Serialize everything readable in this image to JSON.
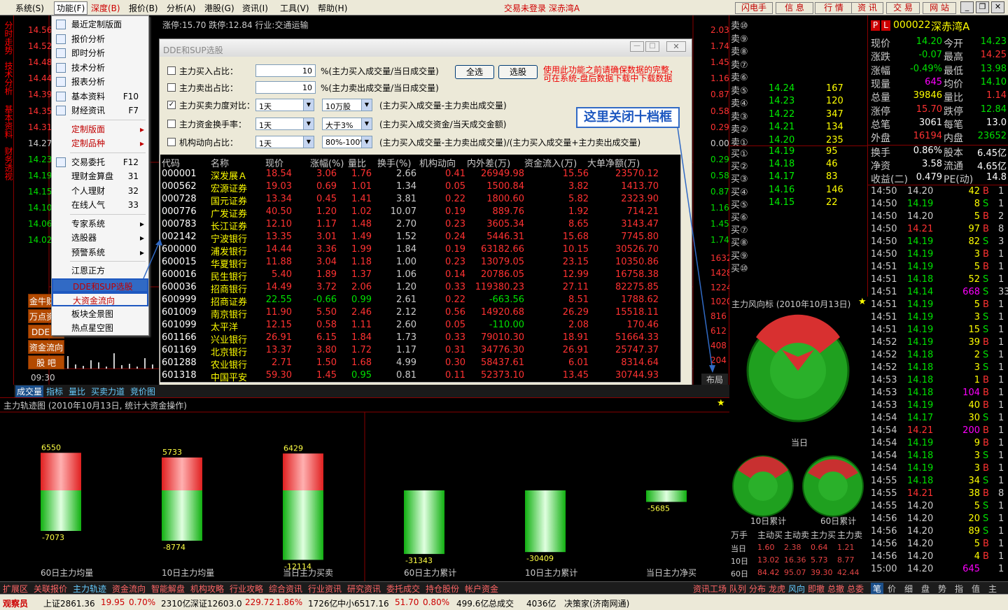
{
  "menubar": {
    "items": [
      "系统(S)",
      "功能(F)",
      "深度(B)",
      "报价(B)",
      "分析(A)",
      "港股(G)",
      "资讯(I)",
      "工具(V)",
      "帮助(H)"
    ],
    "status": "交易未登录 深赤湾A",
    "buttons": [
      "闪电手",
      "信 息",
      "行 情",
      "资 讯",
      "交 易",
      "网 站"
    ]
  },
  "leftbar": {
    "tabs": [
      "分时走势",
      "技术分析",
      "基本资料",
      "财务透视"
    ]
  },
  "chart": {
    "header": "涨停:15.70 跌停:12.84 行业:交通运输",
    "yleft": [
      "14.56",
      "14.52",
      "14.48",
      "14.44",
      "14.39",
      "14.35",
      "14.31",
      "14.27",
      "14.23",
      "14.19",
      "14.15",
      "14.10",
      "14.06",
      "14.02"
    ],
    "yright": [
      "2.03%",
      "1.74%",
      "1.45%",
      "1.16%",
      "0.87%",
      "0.58%",
      "0.29%",
      "0.00%",
      "0.29%",
      "0.58%",
      "0.87%",
      "1.16%",
      "1.45%",
      "1.74%"
    ],
    "yvol": [
      "1632",
      "1428",
      "1224",
      "1020",
      "816",
      "612",
      "408",
      "204"
    ],
    "time": "09:30",
    "layout_btn": "布局",
    "side_buttons": [
      "金牛财经",
      "万点资讯",
      "DDE 数据",
      "资金流向",
      "股 吧"
    ]
  },
  "func_menu": {
    "items": [
      {
        "label": "最近定制版面",
        "key": ""
      },
      {
        "label": "报价分析",
        "key": ""
      },
      {
        "label": "即时分析",
        "key": ""
      },
      {
        "label": "技术分析",
        "key": ""
      },
      {
        "label": "报表分析",
        "key": ""
      },
      {
        "label": "基本资料",
        "key": "F10"
      },
      {
        "label": "财经资讯",
        "key": "F7"
      },
      {
        "label": "定制版面",
        "key": ""
      },
      {
        "label": "定制品种",
        "key": ""
      },
      {
        "label": "交易委托",
        "key": "F12"
      },
      {
        "label": "理财金算盘",
        "key": "31"
      },
      {
        "label": "个人理财",
        "key": "32"
      },
      {
        "label": "在线人气",
        "key": "33"
      },
      {
        "label": "专家系统",
        "key": ""
      },
      {
        "label": "选股器",
        "key": ""
      },
      {
        "label": "预警系统",
        "key": ""
      },
      {
        "label": "江恩正方",
        "key": ""
      },
      {
        "label": "DDE和SUP选股",
        "key": ""
      },
      {
        "label": "大资金流向",
        "key": ""
      },
      {
        "label": "板块全景图",
        "key": ""
      },
      {
        "label": "热点星空图",
        "key": ""
      }
    ]
  },
  "dialog": {
    "title": "DDE和SUP选股",
    "rows": [
      {
        "label": "主力买入占比：",
        "checked": false,
        "value": "10",
        "desc": "%(主力买入成交量/当日成交量)"
      },
      {
        "label": "主力卖出占比：",
        "checked": false,
        "value": "10",
        "desc": "%(主力卖出成交量/当日成交量)"
      },
      {
        "label": "主力买卖力度对比：",
        "checked": true,
        "sel1": "1天",
        "sel2": "10万股",
        "desc": "(主力买入成交量-主力卖出成交量)"
      },
      {
        "label": "主力资金换手率：",
        "checked": false,
        "sel1": "1天",
        "sel2": "大于3%",
        "desc": "(主力买入成交资金/当天成交金额)"
      },
      {
        "label": "机构动向占比：",
        "checked": false,
        "sel1": "1天",
        "sel2": "80%-100%",
        "desc": "(主力买入成交量-主力卖出成交量)/(主力买入成交量+主力卖出成交量)"
      }
    ],
    "btn_all": "全选",
    "btn_pick": "选股",
    "warning1": "使用此功能之前请确保数据的完整，",
    "warning2": "可在系统-盘后数据下载中下载数据",
    "annotation": "这里关闭十档框",
    "columns": [
      "代码",
      "名称",
      "现价",
      "涨幅(%)",
      "量比",
      "换手(%)",
      "机构动向",
      "内外差(万)",
      "资金流入(万)",
      "大单净额(万)"
    ],
    "table": [
      [
        "000001",
        "深发展Ａ",
        "18.54",
        "3.06",
        "1.76",
        "2.66",
        "0.41",
        "26949.98",
        "15.56",
        "23570.12"
      ],
      [
        "000562",
        "宏源证券",
        "19.03",
        "0.69",
        "1.01",
        "1.34",
        "0.05",
        "1500.84",
        "3.82",
        "1413.70"
      ],
      [
        "000728",
        "国元证券",
        "13.34",
        "0.45",
        "1.41",
        "3.81",
        "0.22",
        "1800.60",
        "5.82",
        "2323.90"
      ],
      [
        "000776",
        "广发证券",
        "40.50",
        "1.20",
        "1.02",
        "10.07",
        "0.19",
        "889.76",
        "1.92",
        "714.21"
      ],
      [
        "000783",
        "长江证券",
        "12.10",
        "1.17",
        "1.48",
        "2.70",
        "0.23",
        "3605.34",
        "8.65",
        "3143.47"
      ],
      [
        "002142",
        "宁波银行",
        "13.35",
        "3.01",
        "1.49",
        "1.52",
        "0.24",
        "5446.31",
        "15.68",
        "7745.80"
      ],
      [
        "600000",
        "浦发银行",
        "14.44",
        "3.36",
        "1.99",
        "1.84",
        "0.19",
        "63182.66",
        "10.15",
        "30526.70"
      ],
      [
        "600015",
        "华夏银行",
        "11.88",
        "3.04",
        "1.18",
        "1.00",
        "0.23",
        "13079.05",
        "23.15",
        "10350.86"
      ],
      [
        "600016",
        "民生银行",
        "5.40",
        "1.89",
        "1.37",
        "1.06",
        "0.14",
        "20786.05",
        "12.99",
        "16758.38"
      ],
      [
        "600036",
        "招商银行",
        "14.49",
        "3.72",
        "2.06",
        "1.20",
        "0.33",
        "119380.23",
        "27.11",
        "82275.85"
      ],
      [
        "600999",
        "招商证券",
        "22.55",
        "-0.66",
        "0.99",
        "2.61",
        "0.22",
        "-663.56",
        "8.51",
        "1788.62"
      ],
      [
        "601009",
        "南京银行",
        "11.90",
        "5.50",
        "2.46",
        "2.12",
        "0.56",
        "14920.68",
        "26.29",
        "15518.11"
      ],
      [
        "601099",
        "太平洋",
        "12.15",
        "0.58",
        "1.11",
        "2.60",
        "0.05",
        "-110.00",
        "2.08",
        "170.46"
      ],
      [
        "601166",
        "兴业银行",
        "26.91",
        "6.15",
        "1.84",
        "1.73",
        "0.33",
        "79010.30",
        "18.91",
        "51664.33"
      ],
      [
        "601169",
        "北京银行",
        "13.37",
        "3.80",
        "1.72",
        "1.17",
        "0.31",
        "34776.30",
        "26.91",
        "25747.37"
      ],
      [
        "601288",
        "农业银行",
        "2.71",
        "1.50",
        "1.68",
        "4.99",
        "0.30",
        "58437.61",
        "6.01",
        "8314.64"
      ],
      [
        "601318",
        "中国平安",
        "59.30",
        "1.45",
        "0.95",
        "0.81",
        "0.11",
        "52373.10",
        "13.45",
        "30744.93"
      ]
    ]
  },
  "book": {
    "sell": [
      [
        "卖⑩",
        "",
        ""
      ],
      [
        "卖⑨",
        "",
        ""
      ],
      [
        "卖⑧",
        "",
        ""
      ],
      [
        "卖⑦",
        "",
        ""
      ],
      [
        "卖⑥",
        "",
        ""
      ],
      [
        "卖⑤",
        "14.24",
        "167"
      ],
      [
        "卖④",
        "14.23",
        "120"
      ],
      [
        "卖③",
        "14.22",
        "347"
      ],
      [
        "卖②",
        "14.21",
        "134"
      ],
      [
        "卖①",
        "14.20",
        "235"
      ]
    ],
    "buy": [
      [
        "买①",
        "14.19",
        "95"
      ],
      [
        "买②",
        "14.18",
        "46"
      ],
      [
        "买③",
        "14.17",
        "83"
      ],
      [
        "买④",
        "14.16",
        "146"
      ],
      [
        "买⑤",
        "14.15",
        "22"
      ],
      [
        "买⑥",
        "",
        ""
      ],
      [
        "买⑦",
        "",
        ""
      ],
      [
        "买⑧",
        "",
        ""
      ],
      [
        "买⑨",
        "",
        ""
      ],
      [
        "买⑩",
        "",
        ""
      ]
    ]
  },
  "quote": {
    "code": "000022",
    "name": "深赤湾A",
    "pl": [
      "P",
      "L"
    ],
    "rows": [
      [
        "现价",
        "14.20",
        "今开",
        "14.23"
      ],
      [
        "涨跌",
        "-0.07",
        "最高",
        "14.25"
      ],
      [
        "涨幅",
        "-0.49%",
        "最低",
        "13.98"
      ],
      [
        "现量",
        "645",
        "均价",
        "14.10"
      ],
      [
        "总量",
        "39846",
        "量比",
        "1.14"
      ],
      [
        "涨停",
        "15.70",
        "跌停",
        "12.84"
      ],
      [
        "总笔",
        "3061",
        "每笔",
        "13.0"
      ],
      [
        "外盘",
        "16194",
        "内盘",
        "23652"
      ]
    ],
    "rows2": [
      [
        "换手",
        "0.86%",
        "股本",
        "6.45亿"
      ],
      [
        "净资",
        "3.58",
        "流通",
        "4.65亿"
      ],
      [
        "收益(二)",
        "0.479",
        "PE(动)",
        "14.8"
      ]
    ],
    "ticks": [
      [
        "14:50",
        "14.20",
        "42",
        "B"
      ],
      [
        "14:50",
        "14.19",
        "8",
        "S"
      ],
      [
        "14:50",
        "14.20",
        "5",
        "B"
      ],
      [
        "14:50",
        "14.21",
        "97",
        "B"
      ],
      [
        "14:50",
        "14.19",
        "82",
        "S"
      ],
      [
        "14:50",
        "14.19",
        "3",
        "B"
      ],
      [
        "14:51",
        "14.19",
        "5",
        "B"
      ],
      [
        "14:51",
        "14.18",
        "52",
        "S"
      ],
      [
        "14:51",
        "14.14",
        "668",
        "S"
      ],
      [
        "14:51",
        "14.19",
        "5",
        "B"
      ],
      [
        "14:51",
        "14.19",
        "3",
        "S"
      ],
      [
        "14:51",
        "14.19",
        "15",
        "S"
      ],
      [
        "14:52",
        "14.19",
        "39",
        "B"
      ],
      [
        "14:52",
        "14.18",
        "2",
        "S"
      ],
      [
        "14:52",
        "14.18",
        "3",
        "S"
      ],
      [
        "14:53",
        "14.18",
        "1",
        "B"
      ],
      [
        "14:53",
        "14.18",
        "104",
        "B"
      ],
      [
        "14:53",
        "14.19",
        "40",
        "B"
      ],
      [
        "14:54",
        "14.17",
        "30",
        "S"
      ],
      [
        "14:54",
        "14.21",
        "200",
        "B"
      ],
      [
        "14:54",
        "14.19",
        "9",
        "B"
      ],
      [
        "14:54",
        "14.18",
        "3",
        "S"
      ],
      [
        "14:54",
        "14.19",
        "3",
        "B"
      ],
      [
        "14:55",
        "14.18",
        "34",
        "S"
      ],
      [
        "14:55",
        "14.21",
        "38",
        "B"
      ],
      [
        "14:55",
        "14.20",
        "5",
        "S"
      ],
      [
        "14:56",
        "14.20",
        "20",
        "S"
      ],
      [
        "14:56",
        "14.20",
        "89",
        "S"
      ],
      [
        "14:56",
        "14.20",
        "5",
        "B"
      ],
      [
        "14:56",
        "14.20",
        "4",
        "B"
      ],
      [
        "15:00",
        "14.20",
        "645",
        ""
      ]
    ],
    "tick_extra": [
      "1",
      "1",
      "2",
      "8",
      "3",
      "1",
      "1",
      "1",
      "33",
      "1",
      "1",
      "1",
      "1",
      "1",
      "1",
      "1",
      "1",
      "1",
      "1",
      "1",
      "1",
      "1",
      "1",
      "1",
      "8",
      "1",
      "1",
      "1",
      "1",
      "1",
      "1"
    ]
  },
  "wind": {
    "title": "主力风向标 (2010年10月13日)",
    "today": "当日",
    "d10": "10日累计",
    "d60": "60日累计",
    "hdr": [
      "万手",
      "主动买",
      "主动卖",
      "主力买",
      "主力卖"
    ],
    "rows": [
      [
        "当日",
        "1.60",
        "2.38",
        "0.64",
        "1.21"
      ],
      [
        "10日",
        "13.02",
        "16.36",
        "5.73",
        "8.77"
      ],
      [
        "60日",
        "84.42",
        "95.07",
        "39.30",
        "42.44"
      ]
    ]
  },
  "bottom_tabs": [
    "成交量",
    "指标",
    "量比",
    "买卖力道",
    "竞价图"
  ],
  "trace": {
    "title": "主力轨迹图 (2010年10月13日, 统计大资金操作)",
    "bars": [
      {
        "up": 6550,
        "down": -7073,
        "cap": "60日主力均量"
      },
      {
        "up": 5733,
        "down": -8774,
        "cap": "10日主力均量"
      },
      {
        "up": 6429,
        "down": -12114,
        "cap": "当日主力买卖"
      },
      {
        "up": 0,
        "down": -31343,
        "cap": "60日主力累计"
      },
      {
        "up": 0,
        "down": -30409,
        "cap": "10日主力累计"
      },
      {
        "up": 0,
        "down": -5685,
        "cap": "当日主力净买"
      }
    ]
  },
  "footer_tabs": [
    "扩展区",
    "关联报价",
    "主力轨迹",
    "资金流向",
    "智能解盘",
    "机构攻略",
    "行业攻略",
    "综合资讯",
    "行业资讯",
    "研究资讯",
    "委托成交",
    "持仓股份",
    "帐户资金"
  ],
  "footer_right": [
    "资讯工场",
    "队列",
    "分布",
    "龙虎",
    "风向",
    "即撤",
    "总撤",
    "总委"
  ],
  "footer_right2": [
    "笔",
    "价",
    "细",
    "盘",
    "势",
    "指",
    "值",
    "主"
  ],
  "statusbar": {
    "user": "观察员",
    "sh": "上证2861.36",
    "sh_chg": "19.95",
    "sh_pct": "0.70%",
    "sh_amt": "2310亿",
    "sz": "深证12603.0",
    "sz_chg": "229.72",
    "sz_pct": "1.86%",
    "sz_amt": "1726亿",
    "zx": "中小6517.16",
    "zx_chg": "51.70",
    "zx_pct": "0.80%",
    "zx_amt": "499.6亿",
    "tot_lbl": "总成交",
    "tot": "4036亿",
    "site": "决策家(济南网通)"
  },
  "colors": {
    "up": "#ff3232",
    "down": "#00e000",
    "flat": "#cccccc"
  }
}
